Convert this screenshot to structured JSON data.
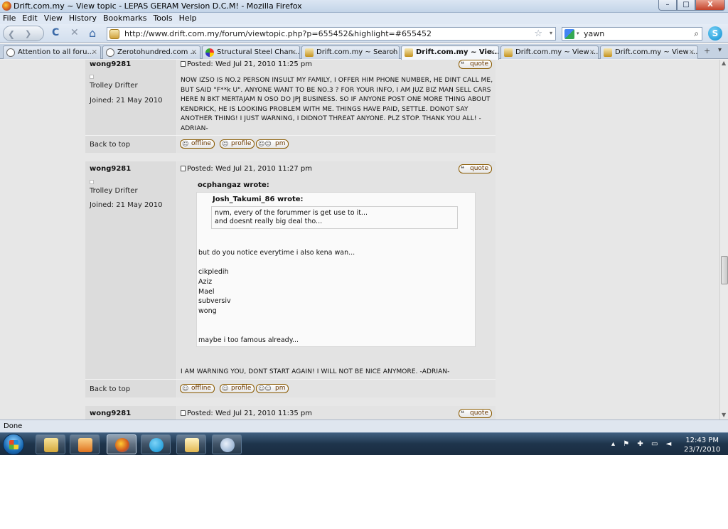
{
  "window": {
    "title": "Drift.com.my ~ View topic - LEPAS GERAM Version D.C.M! - Mozilla Firefox",
    "min": "–",
    "max": "□",
    "close": "X"
  },
  "menu": [
    "File",
    "Edit",
    "View",
    "History",
    "Bookmarks",
    "Tools",
    "Help"
  ],
  "nav": {
    "back": "❮",
    "forward": "❯",
    "reload": "C",
    "stop": "✕",
    "home": "⌂",
    "url": "http://www.drift.com.my/forum/viewtopic.php?p=655452&highlight=#655452",
    "star": "☆",
    "drop": "▾",
    "search_value": "yawn",
    "search_drop": "▾",
    "search_mag": "⌕",
    "ext": "S"
  },
  "tabs": [
    {
      "label": "Attention to all foru...",
      "icon": "gray",
      "close": "×"
    },
    {
      "label": "Zerotohundred.com ...",
      "icon": "gray",
      "close": "×"
    },
    {
      "label": "Structural Steel Chan...",
      "icon": "multi",
      "close": "×"
    },
    {
      "label": "Drift.com.my ~ Search",
      "icon": "drift",
      "close": "×"
    },
    {
      "label": "Drift.com.my ~ Vie...",
      "icon": "drift",
      "close": "×",
      "active": true
    },
    {
      "label": "Drift.com.my ~ View ...",
      "icon": "drift",
      "close": "×"
    },
    {
      "label": "Drift.com.my ~ View ...",
      "icon": "drift",
      "close": "×"
    }
  ],
  "tab_new": "+",
  "tab_list": "▾",
  "posts": [
    {
      "author": "wong9281",
      "posted": "Posted: Wed Jul 21, 2010 11:25 pm",
      "rank": "Trolley Drifter",
      "joined": "Joined: 21 May 2010",
      "message": "NOW IZSO IS NO.2 PERSON INSULT MY FAMILY, I OFFER HIM PHONE NUMBER, HE DINT CALL ME, BUT SAID \"F**k U\". ANYONE WANT TO BE NO.3 ? FOR YOUR INFO, I AM JUZ BIZ MAN SELL CARS HERE N BKT MERTAJAM N OSO DO JPJ BUSINESS. SO IF ANYONE POST ONE MORE THING ABOUT KENDRICK, HE IS LOOKING PROBLEM WITH ME. THINGS HAVE PAID, SETTLE. DONOT SAY ANOTHER THING! I JUST WARNING, I DIDNOT THREAT ANYONE. PLZ STOP. THANK YOU ALL! -ADRIAN-"
    },
    {
      "author": "wong9281",
      "posted": "Posted: Wed Jul 21, 2010 11:27 pm",
      "rank": "Trolley Drifter",
      "joined": "Joined: 21 May 2010",
      "quote_outer_author": "ocphangaz wrote:",
      "quote_inner_author": "Josh_Takumi_86 wrote:",
      "quote_inner_lines": [
        "nvm, every of the forummer is get use to it...",
        "and doesnt really big deal tho..."
      ],
      "quote_lines": [
        "but do you notice everytime i also kena wan...",
        "cikpledih",
        "Aziz",
        "Mael",
        "subversiv",
        "wong",
        "maybe i too famous already..."
      ],
      "message": "I AM WARNING YOU, DONT START AGAIN! I WILL NOT BE NICE ANYMORE. -ADRIAN-"
    },
    {
      "author": "wong9281",
      "posted": "Posted: Wed Jul 21, 2010 11:35 pm"
    }
  ],
  "buttons": {
    "quote": "quote",
    "offline": "offline",
    "profile": "profile",
    "pm": "pm"
  },
  "back_to_top": "Back to top",
  "status": "Done",
  "scroll": {
    "up": "▲",
    "down": "▼"
  },
  "tray": {
    "up_arrow": "▴",
    "flag": "⚑",
    "clock_time": "12:43 PM",
    "clock_date": "23/7/2010"
  }
}
